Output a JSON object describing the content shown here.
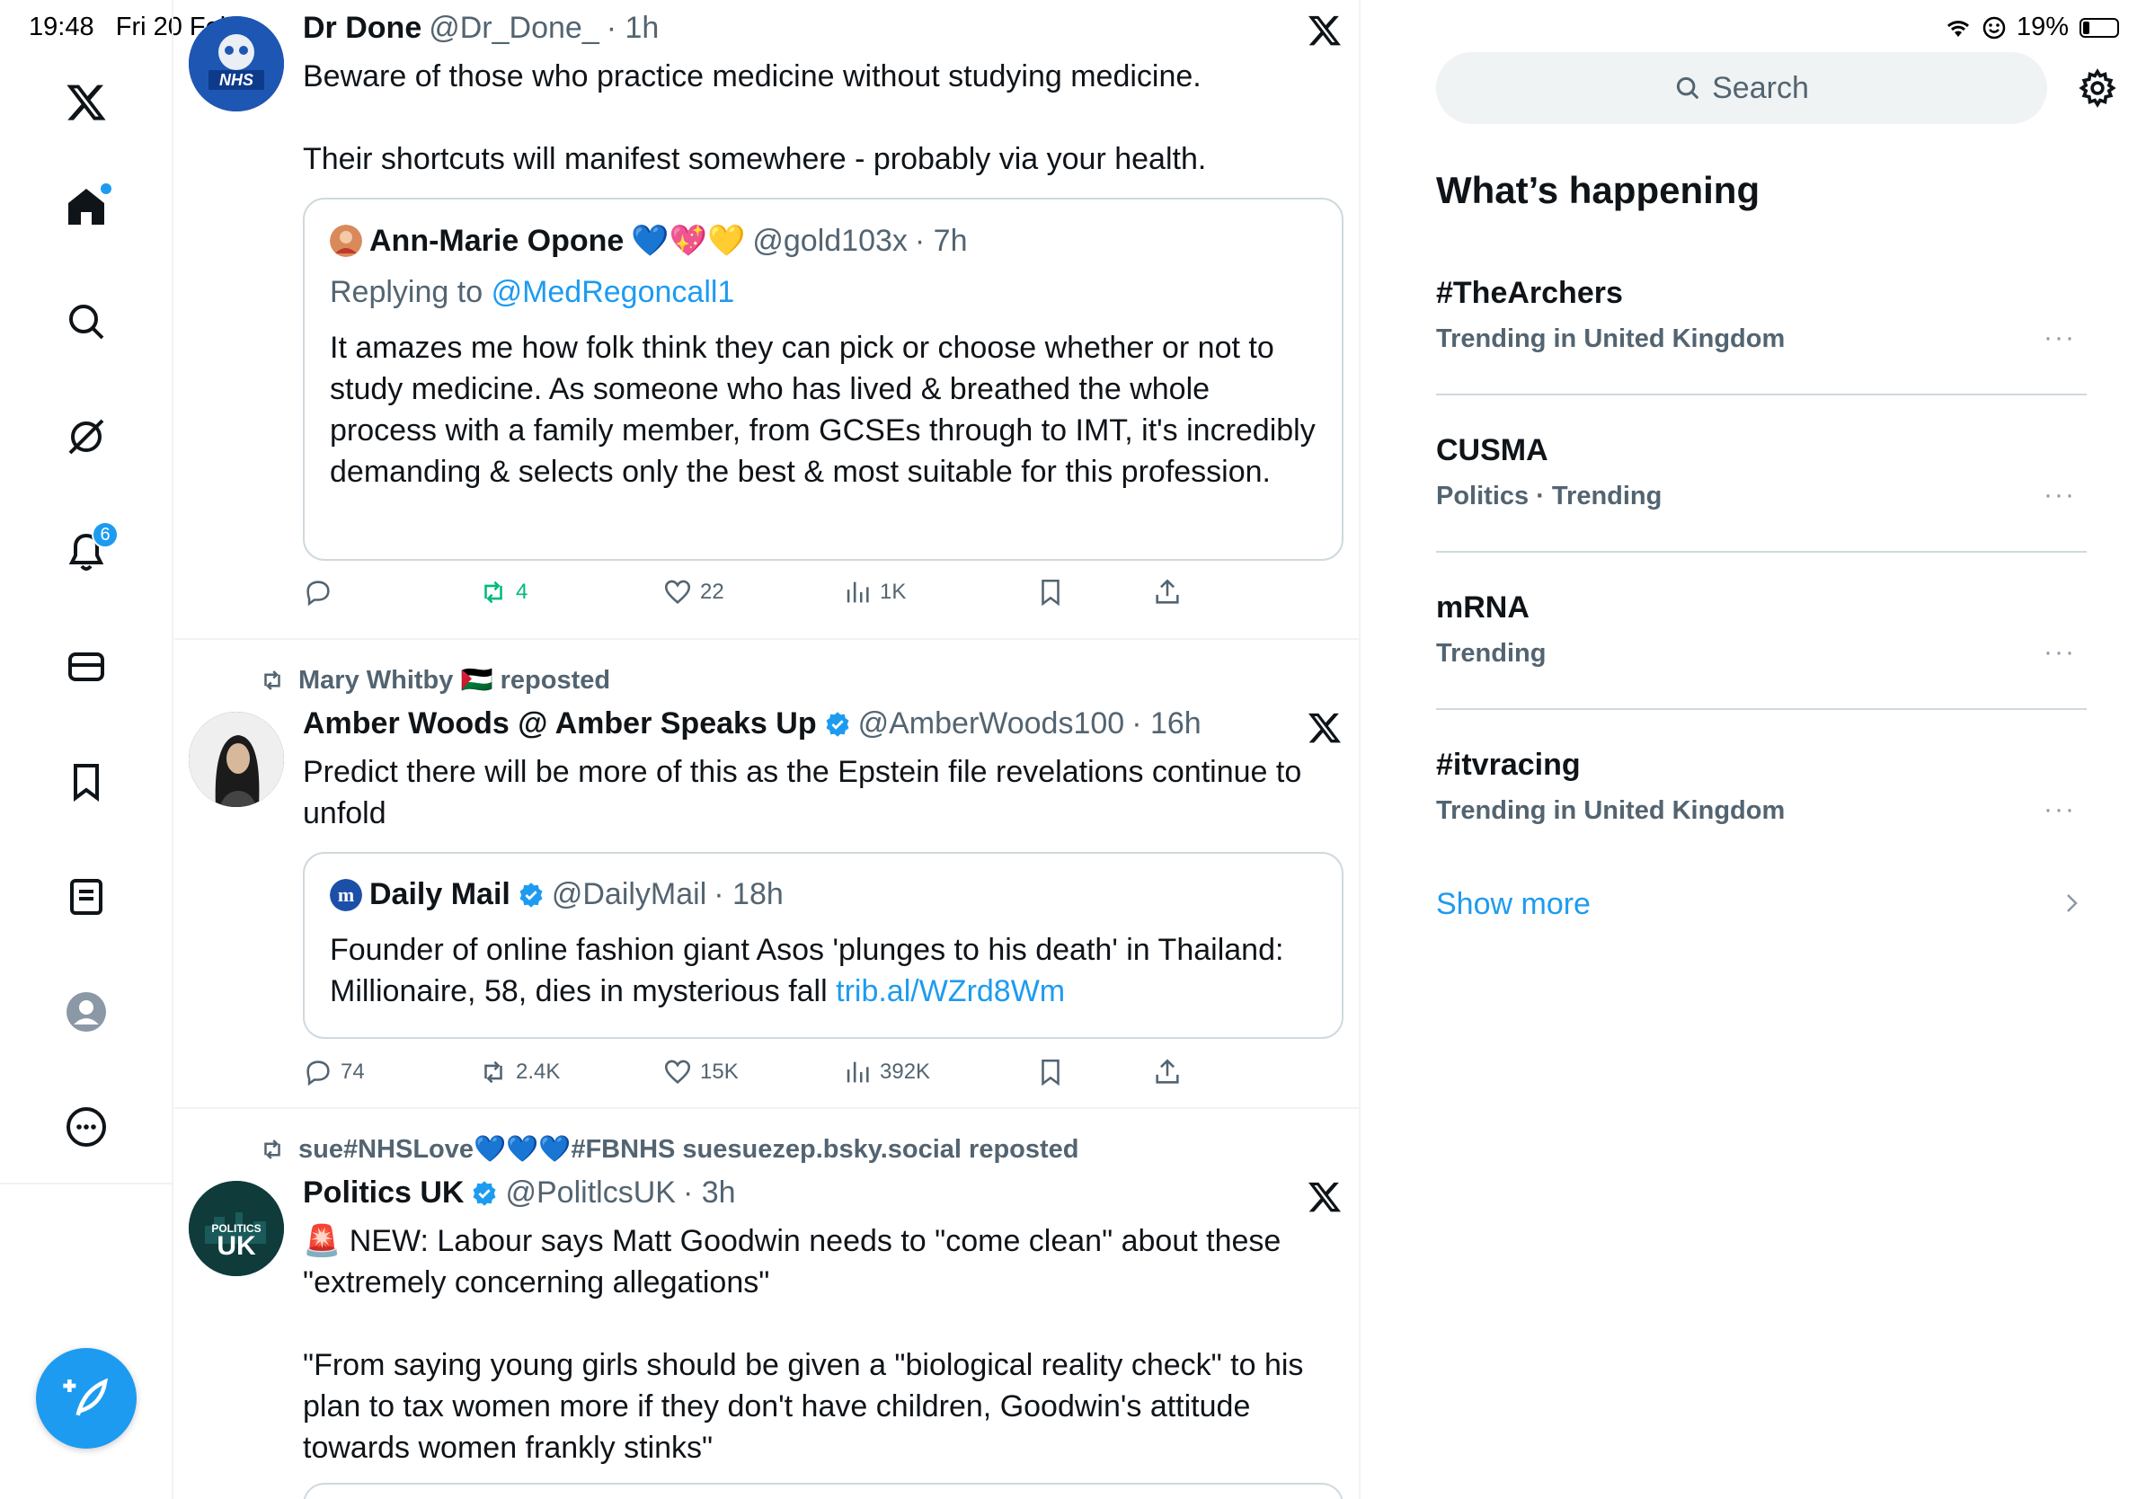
{
  "status_bar": {
    "time": "19:48",
    "date": "Fri 20 Feb",
    "battery": "19%",
    "battery_level": 0.19
  },
  "nav": {
    "notifications_badge": "6"
  },
  "tweets": [
    {
      "name": "Dr Done",
      "handle": "@Dr_Done_",
      "time": "· 1h",
      "text": "Beware of those who practice medicine without studying medicine.\n\nTheir shortcuts will manifest somewhere - probably via your health.",
      "quote": {
        "name": "Ann-Marie Opone",
        "emojis": "💙💖💛",
        "handle": "@gold103x",
        "time": "· 7h",
        "replying_prefix": "Replying to",
        "replying_to": "@MedRegoncall1",
        "text": "It amazes me how folk think they can pick or choose whether or not to study medicine. As someone who has lived & breathed the whole process with a family member, from GCSEs through to IMT, it's incredibly demanding & selects only the best & most suitable for this profession."
      },
      "stats": {
        "reposts": "4",
        "likes": "22",
        "views": "1K"
      }
    },
    {
      "repost_by": "Mary Whitby 🇵🇸 reposted",
      "name": "Amber Woods @ Amber Speaks Up",
      "handle": "@AmberWoods100",
      "time": "· 16h",
      "text": "Predict there will be more of this as the Epstein file revelations continue to unfold",
      "quote": {
        "name": "Daily Mail",
        "handle": "@DailyMail",
        "time": "· 18h",
        "text": "Founder of online fashion giant Asos 'plunges to his death' in Thailand: Millionaire, 58, dies in mysterious fall",
        "link": "trib.al/WZrd8Wm"
      },
      "stats": {
        "replies": "74",
        "reposts": "2.4K",
        "likes": "15K",
        "views": "392K"
      }
    },
    {
      "repost_by": "sue#NHSLove💙💙💙#FBNHS suesuezep.bsky.social reposted",
      "name": "Politics UK",
      "handle": "@PolitlcsUK",
      "time": "· 3h",
      "text": "🚨 NEW: Labour says Matt Goodwin needs to \"come clean\" about these \"extremely concerning allegations\"\n\n\"From saying young girls should be given a \"biological reality check\" to his plan to tax women more if they don't have children, Goodwin's attitude towards women frankly stinks\""
    }
  ],
  "sidebar": {
    "search_placeholder": "Search",
    "title": "What’s happening",
    "trends": [
      {
        "name": "#TheArchers",
        "context": "Trending in United Kingdom"
      },
      {
        "name": "CUSMA",
        "context": "Politics · Trending"
      },
      {
        "name": "mRNA",
        "context": "Trending"
      },
      {
        "name": "#itvracing",
        "context": "Trending in United Kingdom"
      }
    ],
    "more_label": "···",
    "show_more": "Show more"
  },
  "colors": {
    "accent": "#1d9bf0",
    "text": "#0f1419",
    "secondary": "#536471",
    "border": "#eff3f4",
    "repost_green": "#00ba7c"
  }
}
